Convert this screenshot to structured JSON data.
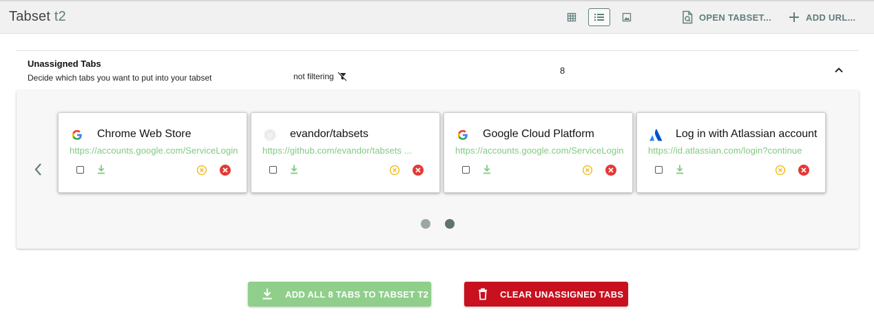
{
  "toolbar": {
    "title_main": "Tabset",
    "title_sub": "t2",
    "view_grid_icon": "grid-icon",
    "view_list_icon": "list-icon",
    "view_image_icon": "image-icon",
    "open_tabset_label": "OPEN TABSET...",
    "add_url_label": "ADD URL..."
  },
  "panel": {
    "title": "Unassigned Tabs",
    "caption": "Decide which tabs you want to put into your tabset",
    "filter_label": "not filtering",
    "count": "8"
  },
  "cards": [
    {
      "title": "Chrome Web Store",
      "url": "https://accounts.google.com/ServiceLogin",
      "favicon": "google-icon"
    },
    {
      "title": "evandor/tabsets",
      "url": "https://github.com/evandor/tabsets ...",
      "favicon": "github-icon"
    },
    {
      "title": "Google Cloud Platform",
      "url": "https://accounts.google.com/ServiceLogin",
      "favicon": "google-icon"
    },
    {
      "title": "Log in with Atlassian account",
      "url": "https://id.atlassian.com/login?continue",
      "favicon": "atlassian-icon"
    }
  ],
  "pagination": {
    "pages": 2,
    "current": 2
  },
  "actions": {
    "add_all_label": "ADD ALL 8 TABS TO TABSET T2",
    "clear_label": "CLEAR UNASSIGNED TABS"
  },
  "colors": {
    "accent": "#5e7d7a",
    "url_green": "#7fc97f",
    "add_button": "#8fcf8b",
    "clear_button": "#c8101e",
    "close_orange": "#f0b400",
    "delete_red": "#e53935"
  }
}
